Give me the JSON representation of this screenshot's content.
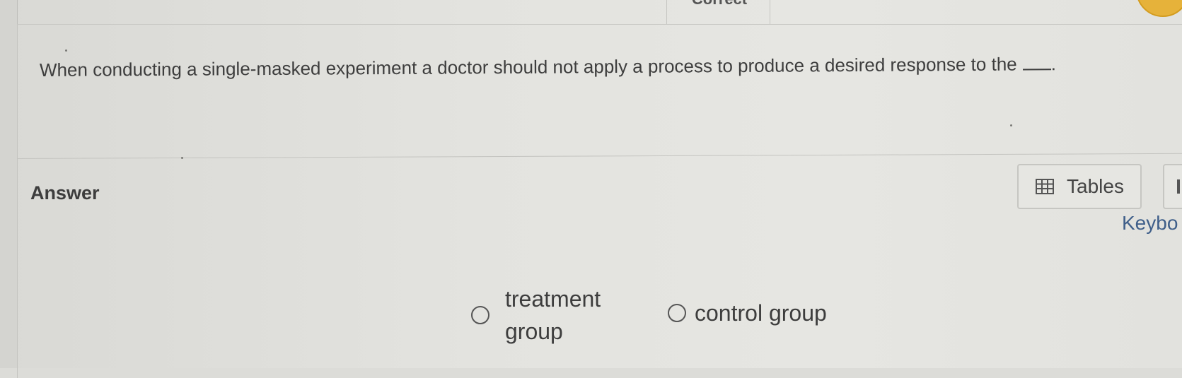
{
  "header": {
    "status_fragment": "Correct"
  },
  "question": {
    "text": "When conducting a single-masked experiment a doctor should not apply a process to produce a desired response to the",
    "end_punctuation": "."
  },
  "answer": {
    "label": "Answer",
    "tables_button": {
      "label": "Tables",
      "icon": "table-icon"
    },
    "keyboard_link": "Keybo",
    "options": [
      {
        "label": "treatment group",
        "selected": false
      },
      {
        "label": "control group",
        "selected": false
      }
    ]
  },
  "colors": {
    "background": "#e2e2de",
    "text": "#3d3d3d",
    "link": "#3f5f8a",
    "avatar": "#e6b23a"
  }
}
